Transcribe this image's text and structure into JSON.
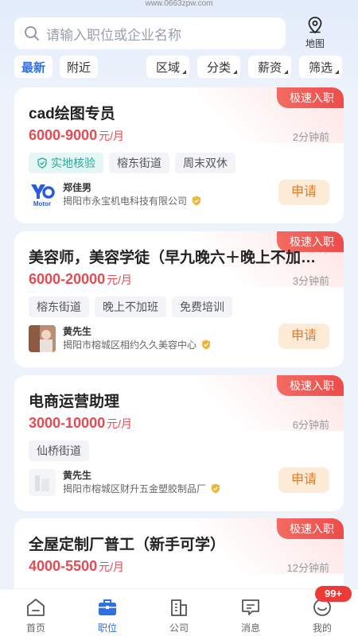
{
  "page": {
    "url": "www.0663zpw.com"
  },
  "search": {
    "placeholder": "请输入职位或企业名称"
  },
  "map": {
    "label": "地图"
  },
  "filters": {
    "latest": "最新",
    "nearby": "附近",
    "area": "区域",
    "category": "分类",
    "salary": "薪资",
    "filter": "筛选"
  },
  "jobs": [
    {
      "badge": "极速入职",
      "title": "cad绘图专员",
      "salary": "6000-9000",
      "salary_unit": "元/月",
      "time": "2分钟前",
      "verified_tag": "实地核验",
      "tags": [
        "榕东街道",
        "周末双休"
      ],
      "person": "郑佳男",
      "company": "揭阳市永宝机电科技有限公司",
      "logo_text": "Motor",
      "apply": "申请"
    },
    {
      "badge": "极速入职",
      "title": "美容师，美容学徒（早九晚六＋晚上不加班）",
      "salary": "6000-20000",
      "salary_unit": "元/月",
      "time": "3分钟前",
      "tags": [
        "榕东街道",
        "晚上不加班",
        "免费培训"
      ],
      "person": "黄先生",
      "company": "揭阳市榕城区相约久久美容中心",
      "apply": "申请"
    },
    {
      "badge": "极速入职",
      "title": "电商运营助理",
      "salary": "3000-10000",
      "salary_unit": "元/月",
      "time": "6分钟前",
      "tags": [
        "仙桥街道"
      ],
      "person": "黄先生",
      "company": "揭阳市榕城区财升五金塑胶制品厂",
      "apply": "申请"
    },
    {
      "badge": "极速入职",
      "title": "全屋定制厂普工（新手可学）",
      "salary": "4000-5500",
      "salary_unit": "元/月",
      "time": "12分钟前"
    }
  ],
  "tabbar": {
    "items": [
      {
        "label": "首页",
        "icon": "home-icon"
      },
      {
        "label": "职位",
        "icon": "briefcase-icon"
      },
      {
        "label": "公司",
        "icon": "building-icon"
      },
      {
        "label": "消息",
        "icon": "message-icon"
      },
      {
        "label": "我的",
        "icon": "profile-icon"
      }
    ],
    "active": "职位",
    "notice_count": "99+"
  },
  "colors": {
    "accent": "#2f6fe4",
    "salary": "#e64a53",
    "badge": "#ee4c4a",
    "apply_text": "#e07b26",
    "apply_bg": "#fdebd8",
    "verify": "#27a99a"
  }
}
